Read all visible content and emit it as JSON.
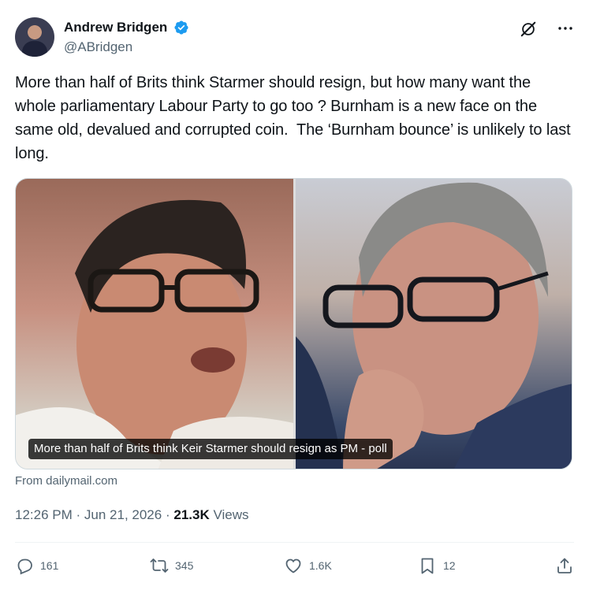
{
  "author": {
    "display_name": "Andrew Bridgen",
    "handle": "@ABridgen",
    "verified": true
  },
  "tweet": {
    "text": "More than half of Brits think Starmer should resign, but how many want the whole parliamentary Labour Party to go too ? Burnham is a new face on the same old, devalued and corrupted coin.  The ‘Burnham bounce’ is unlikely to last long."
  },
  "card": {
    "caption": "More than half of Brits think Keir Starmer should resign as PM - poll",
    "source": "From dailymail.com"
  },
  "meta": {
    "time": "12:26 PM",
    "separator": "·",
    "date": "Jun 21, 2026",
    "views_count": "21.3K",
    "views_label": "Views"
  },
  "actions": {
    "replies": "161",
    "reposts": "345",
    "likes": "1.6K",
    "bookmarks": "12"
  },
  "colors": {
    "verified_blue": "#1d9bf0",
    "secondary_text": "#536471",
    "primary_text": "#0f1419"
  },
  "icons": [
    "verified-badge-icon",
    "grok-icon",
    "more-icon",
    "reply-icon",
    "repost-icon",
    "like-icon",
    "bookmark-icon",
    "share-icon"
  ]
}
